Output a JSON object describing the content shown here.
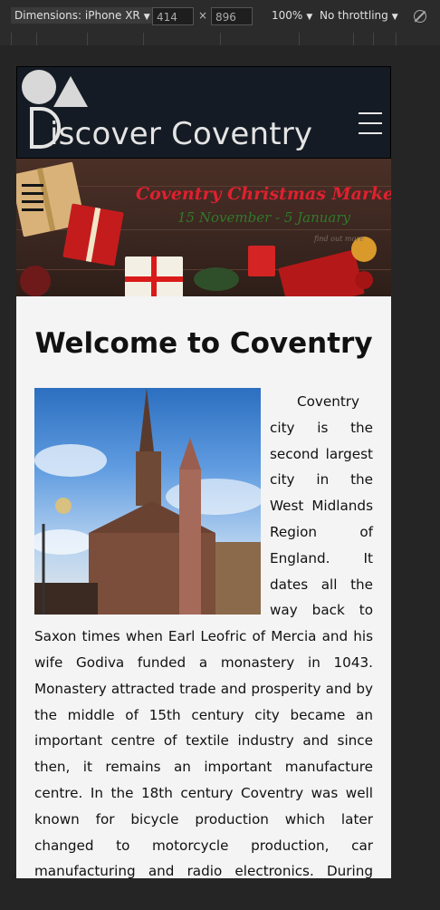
{
  "devtools": {
    "dimensions_label": "Dimensions: iPhone XR",
    "width": "414",
    "height": "896",
    "times": "×",
    "zoom": "100%",
    "throttling": "No throttling"
  },
  "site": {
    "logo_text": "iscover Coventry",
    "banner": {
      "title": "Coventry Christmas Market",
      "dates": "15 November  -  5 January",
      "small": "find out more"
    },
    "page_title": "Welcome to Coventry",
    "intro": "Coventry city is the second largest city in the West Midlands Region of England. It dates all the way back to Saxon times when Earl Leofric of Mercia and his wife Godiva funded a monastery in 1043. Monastery attracted trade and prosperity and by the middle of 15th century city became an important centre of textile industry and since then, it remains an important manufacture centre. In the 18th century Coventry was well known for bicycle production which later changed to motorcycle production, car manufacturing and radio electronics. During WWII air raids most of the city was destroyed including"
  },
  "colors": {
    "header_bg": "#151b24",
    "banner_title": "#e0202f",
    "banner_dates": "#2f7a2a",
    "page_bg": "#f4f4f4"
  },
  "icons": [
    "menu-icon",
    "rotate-disabled-icon",
    "caret-down-icon"
  ]
}
